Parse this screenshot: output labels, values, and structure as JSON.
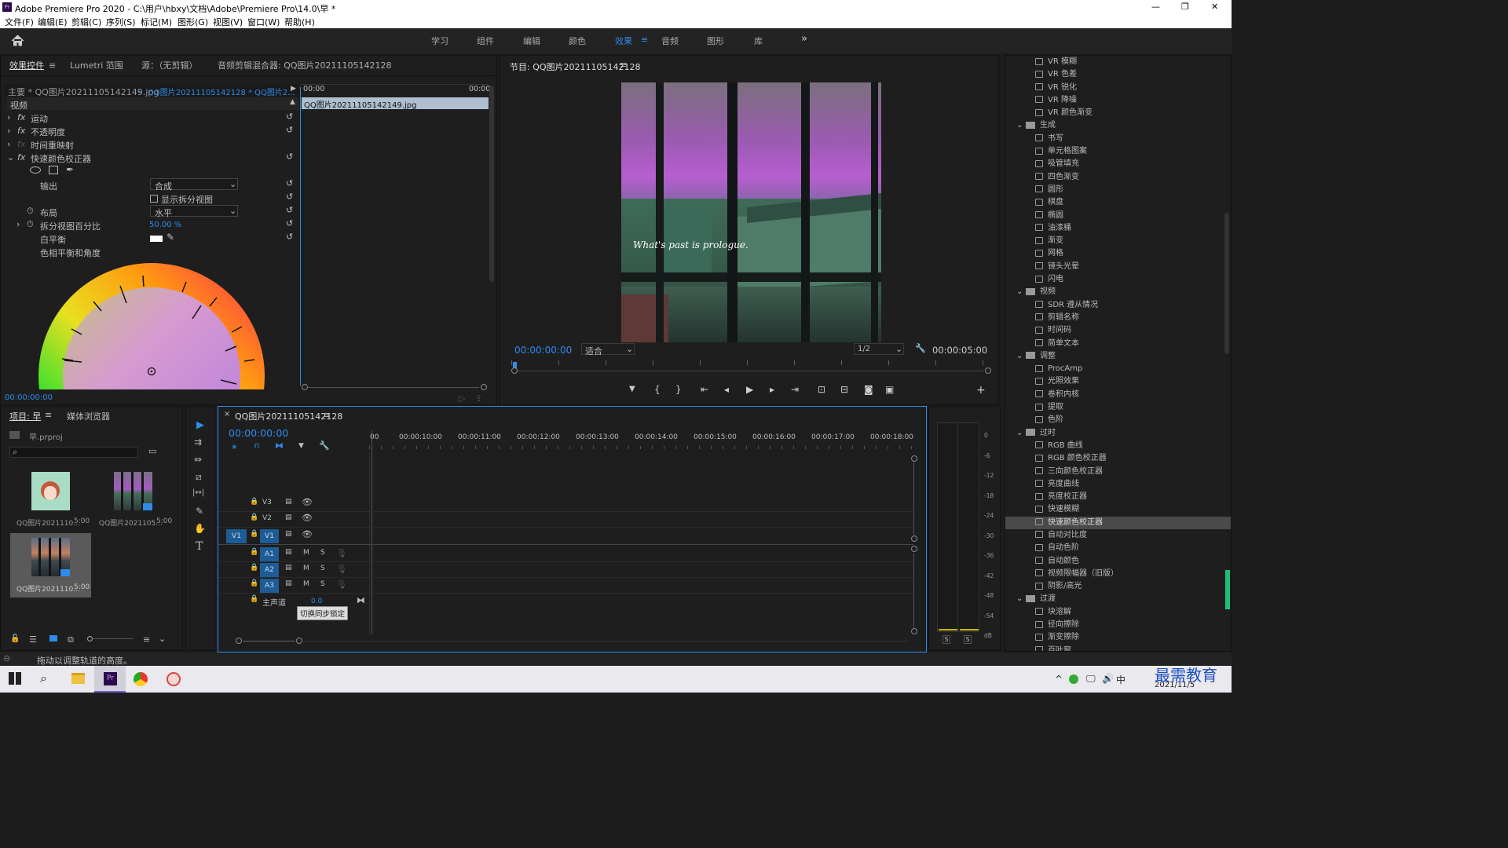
{
  "window": {
    "title": "Adobe Premiere Pro 2020 - C:\\用户\\hbxy\\文档\\Adobe\\Premiere Pro\\14.0\\早 *",
    "controls": [
      "—",
      "❐",
      "✕"
    ]
  },
  "menu": [
    "文件(F)",
    "编辑(E)",
    "剪辑(C)",
    "序列(S)",
    "标记(M)",
    "图形(G)",
    "视图(V)",
    "窗口(W)",
    "帮助(H)"
  ],
  "workspaces": [
    "学习",
    "组件",
    "编辑",
    "颜色",
    "效果",
    "音频",
    "图形",
    "库"
  ],
  "active_workspace": "效果",
  "more": "»",
  "effect_controls": {
    "tabs": [
      "效果控件",
      "Lumetri 范围",
      "源：（无剪辑）",
      "音频剪辑混合器: QQ图片20211105142128"
    ],
    "master": "主要 * QQ图片20211105142149.jpg",
    "seq": "QQ图片20211105142128 * QQ图片2...",
    "t0": "00:00",
    "t1": "00:00",
    "clip_label": "QQ图片20211105142149.jpg",
    "video": "视频",
    "motion": "运动",
    "opacity": "不透明度",
    "timeremap": "时间重映射",
    "fast_color": "快速颜色校正器",
    "output_label": "输出",
    "output_value": "合成",
    "split_view": "显示拆分视图",
    "layout_label": "布局",
    "layout_value": "水平",
    "split_pct_label": "拆分视图百分比",
    "split_pct_value": "50.00 %",
    "wb_label": "白平衡",
    "hue_label": "色相平衡和角度",
    "timecode": "00:00:00:00"
  },
  "program": {
    "title": "节目: QQ图片20211105142128",
    "overlay_text": "What's past is prologue.",
    "timecode": "00:00:00:00",
    "fit": "适合",
    "quality": "1/2",
    "duration": "00:00:05:00",
    "ctrl": [
      "▼",
      "{",
      "}",
      "⇤",
      "◂",
      "▶",
      "▸",
      "⇥",
      "⊡",
      "⊟",
      "◙",
      "▣"
    ],
    "add": "+"
  },
  "project": {
    "tabs": [
      "项目: 早",
      "媒体浏览器"
    ],
    "file": "早.prproj",
    "items": [
      {
        "name": "QQ图片2021110...",
        "dur": "5:00"
      },
      {
        "name": "QQ图片2021105...",
        "dur": "5:00"
      },
      {
        "name": "QQ图片2021110...",
        "dur": "5:00"
      }
    ]
  },
  "tools": [
    "▶",
    "⇉",
    "⇔",
    "⧄",
    "|↔|",
    "✎",
    "✋",
    "T"
  ],
  "timeline": {
    "title": "QQ图片20211105142128",
    "timecode": "00:00:00:00",
    "ruler": [
      "00",
      "00:00:10:00",
      "00:00:11:00",
      "00:00:12:00",
      "00:00:13:00",
      "00:00:14:00",
      "00:00:15:00",
      "00:00:16:00",
      "00:00:17:00",
      "00:00:18:00"
    ],
    "video_tracks": [
      "V3",
      "V2",
      "V1"
    ],
    "audio_tracks": [
      "A1",
      "A2",
      "A3"
    ],
    "src_v": "V1",
    "m": "M",
    "s": "S",
    "master": "主声道",
    "master_val": "0.0",
    "tooltip": "切换同步锁定"
  },
  "meter": {
    "scale": [
      "0",
      "-6",
      "-12",
      "-18",
      "-24",
      "-30",
      "-36",
      "-42",
      "-48",
      "-54",
      "dB"
    ],
    "s": [
      "S",
      "S"
    ]
  },
  "effects_tree": [
    {
      "t": "i",
      "l": "VR 模糊"
    },
    {
      "t": "i",
      "l": "VR 色差"
    },
    {
      "t": "i",
      "l": "VR 锐化"
    },
    {
      "t": "i",
      "l": "VR 降噪"
    },
    {
      "t": "i",
      "l": "VR 颜色渐变"
    },
    {
      "t": "f",
      "l": "生成"
    },
    {
      "t": "i",
      "l": "书写"
    },
    {
      "t": "i",
      "l": "单元格图案"
    },
    {
      "t": "i",
      "l": "吸管填充"
    },
    {
      "t": "i",
      "l": "四色渐变"
    },
    {
      "t": "i",
      "l": "圆形"
    },
    {
      "t": "i",
      "l": "棋盘"
    },
    {
      "t": "i",
      "l": "椭圆"
    },
    {
      "t": "i",
      "l": "油漆桶"
    },
    {
      "t": "i",
      "l": "渐变"
    },
    {
      "t": "i",
      "l": "网格"
    },
    {
      "t": "i",
      "l": "镜头光晕"
    },
    {
      "t": "i",
      "l": "闪电"
    },
    {
      "t": "f",
      "l": "视频"
    },
    {
      "t": "i",
      "l": "SDR 遵从情况"
    },
    {
      "t": "i",
      "l": "剪辑名称"
    },
    {
      "t": "i",
      "l": "时间码"
    },
    {
      "t": "i",
      "l": "简单文本"
    },
    {
      "t": "f",
      "l": "调整"
    },
    {
      "t": "i",
      "l": "ProcAmp"
    },
    {
      "t": "i",
      "l": "光照效果"
    },
    {
      "t": "i",
      "l": "卷积内核"
    },
    {
      "t": "i",
      "l": "提取"
    },
    {
      "t": "i",
      "l": "色阶"
    },
    {
      "t": "f",
      "l": "过时"
    },
    {
      "t": "i",
      "l": "RGB 曲线"
    },
    {
      "t": "i",
      "l": "RGB 颜色校正器"
    },
    {
      "t": "i",
      "l": "三向颜色校正器"
    },
    {
      "t": "i",
      "l": "亮度曲线"
    },
    {
      "t": "i",
      "l": "亮度校正器"
    },
    {
      "t": "i",
      "l": "快速模糊"
    },
    {
      "t": "s",
      "l": "快速颜色校正器"
    },
    {
      "t": "i",
      "l": "自动对比度"
    },
    {
      "t": "i",
      "l": "自动色阶"
    },
    {
      "t": "i",
      "l": "自动颜色"
    },
    {
      "t": "i",
      "l": "视频限幅器（旧版）"
    },
    {
      "t": "i",
      "l": "阴影/高光"
    },
    {
      "t": "f",
      "l": "过渡"
    },
    {
      "t": "i",
      "l": "块溶解"
    },
    {
      "t": "i",
      "l": "径向擦除"
    },
    {
      "t": "i",
      "l": "渐变擦除"
    },
    {
      "t": "i",
      "l": "百叶窗"
    }
  ],
  "status": "拖动以调整轨道的高度。",
  "tray": {
    "ime": "中",
    "date": "2021/11/5",
    "brand": "最需教育"
  },
  "colors": {
    "accent": "#2d8ceb",
    "bg": "#1d1d1d",
    "panel": "#232323"
  }
}
